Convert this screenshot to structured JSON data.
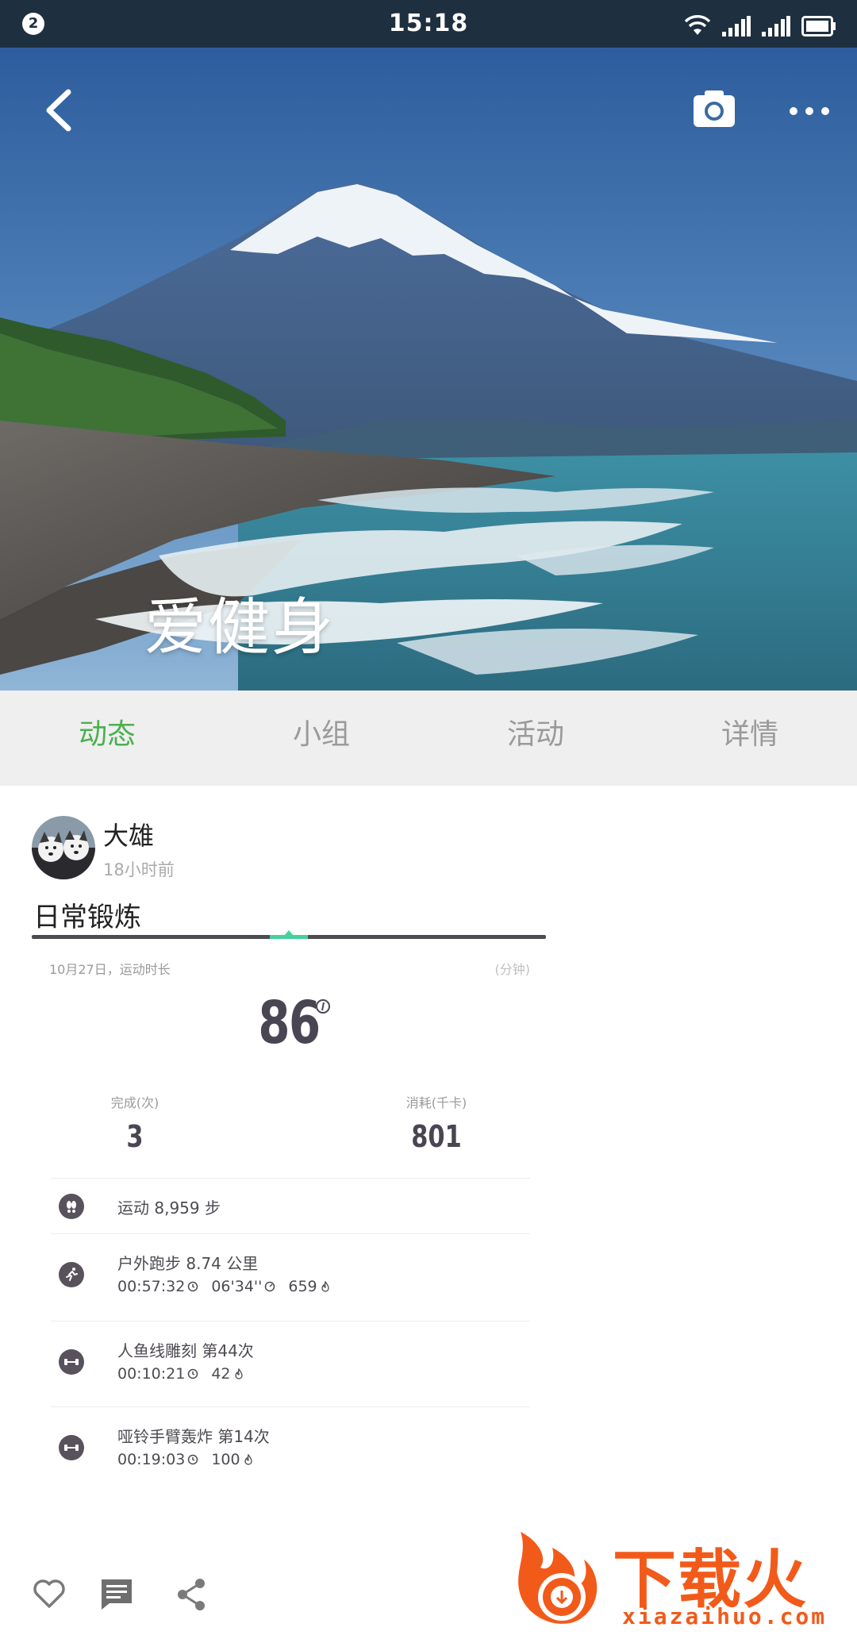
{
  "status_bar": {
    "notification_count": "2",
    "time": "15:18",
    "icons": [
      "wifi-icon",
      "signal-icon",
      "signal-icon",
      "battery-icon"
    ]
  },
  "hero": {
    "title": "爱健身",
    "image_desc": "snow-capped mountain over sea beach"
  },
  "tabs": [
    {
      "label": "动态",
      "active": true
    },
    {
      "label": "小组",
      "active": false
    },
    {
      "label": "活动",
      "active": false
    },
    {
      "label": "详情",
      "active": false
    }
  ],
  "post": {
    "user": "大雄",
    "time": "18小时前",
    "title": "日常锻炼",
    "card": {
      "date_label": "10月27日，运动时长",
      "unit": "(分钟)",
      "duration_minutes": "86",
      "stats": [
        {
          "label": "完成(次)",
          "value": "3"
        },
        {
          "label": "消耗(千卡)",
          "value": "801"
        }
      ],
      "activities": [
        {
          "icon": "footprint-icon",
          "name": "运动 8,959 步",
          "meta": []
        },
        {
          "icon": "running-icon",
          "name": "户外跑步 8.74 公里",
          "meta": [
            {
              "text": "00:57:32",
              "icon": "clock-icon"
            },
            {
              "text": "06'34''",
              "icon": "pace-icon"
            },
            {
              "text": "659",
              "icon": "flame-icon"
            }
          ]
        },
        {
          "icon": "dumbbell-icon",
          "name": "人鱼线雕刻 第44次",
          "meta": [
            {
              "text": "00:10:21",
              "icon": "clock-icon"
            },
            {
              "text": "42",
              "icon": "flame-icon"
            }
          ]
        },
        {
          "icon": "dumbbell-icon",
          "name": "哑铃手臂轰炸 第14次",
          "meta": [
            {
              "text": "00:19:03",
              "icon": "clock-icon"
            },
            {
              "text": "100",
              "icon": "flame-icon"
            }
          ]
        }
      ]
    }
  },
  "watermark": {
    "brand": "下载火",
    "url": "xiazaihuo.com"
  },
  "colors": {
    "status_bar": "#1e2f3f",
    "active_tab": "#4caf50",
    "inactive_tab": "#9a9a9a",
    "tab_bg": "#efefef",
    "card_dark": "#4e4a52",
    "card_accent": "#45d19a",
    "watermark": "#f25a1a"
  }
}
